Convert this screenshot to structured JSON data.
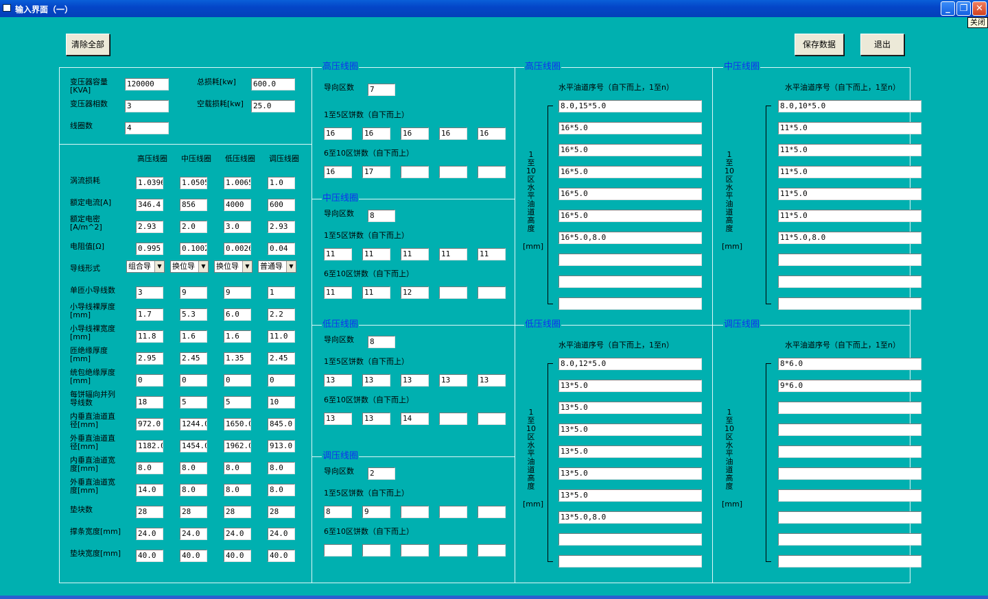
{
  "window": {
    "title": "输入界面（一）",
    "close_tip": "关闭"
  },
  "buttons": {
    "clear": "清除全部",
    "save": "保存数据",
    "exit": "退出"
  },
  "general": {
    "capacity_label": "变压器容量\n[KVA]",
    "capacity": "120000",
    "phases_label": "变压器相数",
    "phases": "3",
    "coils_label": "线圈数",
    "coils": "4",
    "total_loss_label": "总损耗[kw]",
    "total_loss": "600.0",
    "noload_loss_label": "空载损耗[kw]",
    "noload_loss": "25.0"
  },
  "params": {
    "headers": [
      "高压线圈",
      "中压线圈",
      "低压线圈",
      "调压线圈"
    ],
    "rows": [
      {
        "label": "涡流损耗",
        "type": "text",
        "values": [
          "1.0396",
          "1.0505",
          "1.0065",
          "1.0"
        ]
      },
      {
        "label": "额定电流[A]",
        "type": "text",
        "values": [
          "346.4",
          "856",
          "4000",
          "600"
        ]
      },
      {
        "label": "额定电密\n[A/m^2]",
        "type": "text",
        "values": [
          "2.93",
          "2.0",
          "3.0",
          "2.93"
        ]
      },
      {
        "label": "电阻值[Ω]",
        "type": "text",
        "values": [
          "0.995",
          "0.1002",
          "0.0026",
          "0.04"
        ]
      },
      {
        "label": "导线形式",
        "type": "select",
        "values": [
          "组合导",
          "换位导",
          "换位导",
          "普通导"
        ]
      },
      {
        "label": "单匝小导线数",
        "type": "text",
        "values": [
          "3",
          "9",
          "9",
          "1"
        ]
      },
      {
        "label": "小导线裸厚度\n[mm]",
        "type": "text",
        "values": [
          "1.7",
          "5.3",
          "6.0",
          "2.2"
        ]
      },
      {
        "label": "小导线裸宽度\n[mm]",
        "type": "text",
        "values": [
          "11.8",
          "1.6",
          "1.6",
          "11.0"
        ]
      },
      {
        "label": "匝绝缘厚度\n[mm]",
        "type": "text",
        "values": [
          "2.95",
          "2.45",
          "1.35",
          "2.45"
        ]
      },
      {
        "label": "统包绝缘厚度\n[mm]",
        "type": "text",
        "values": [
          "0",
          "0",
          "0",
          "0"
        ]
      },
      {
        "label": "每饼辐向并列\n导线数",
        "type": "text",
        "values": [
          "18",
          "5",
          "5",
          "10"
        ]
      },
      {
        "label": "内垂直油道直\n径[mm]",
        "type": "text",
        "values": [
          "972.0",
          "1244.0",
          "1650.0",
          "845.0"
        ]
      },
      {
        "label": "外垂直油道直\n径[mm]",
        "type": "text",
        "values": [
          "1182.0",
          "1454.0",
          "1962.0",
          "913.0"
        ]
      },
      {
        "label": "内垂直油道宽\n度[mm]",
        "type": "text",
        "values": [
          "8.0",
          "8.0",
          "8.0",
          "8.0"
        ]
      },
      {
        "label": "外垂直油道宽\n度[mm]",
        "type": "text",
        "values": [
          "14.0",
          "8.0",
          "8.0",
          "8.0"
        ]
      },
      {
        "label": "垫块数",
        "type": "text",
        "values": [
          "28",
          "28",
          "28",
          "28"
        ]
      },
      {
        "label": "撑条宽度[mm]",
        "type": "text",
        "values": [
          "24.0",
          "24.0",
          "24.0",
          "24.0"
        ]
      },
      {
        "label": "垫块宽度[mm]",
        "type": "text",
        "values": [
          "40.0",
          "40.0",
          "40.0",
          "40.0"
        ]
      }
    ]
  },
  "cake_labels": {
    "zones": "导向区数",
    "first": "1至5区饼数（自下而上）",
    "second": "6至10区饼数（自下而上）"
  },
  "cakes": [
    {
      "title": "高压线圈",
      "zones": "7",
      "first": [
        "16",
        "16",
        "16",
        "16",
        "16"
      ],
      "second": [
        "16",
        "17",
        "",
        "",
        ""
      ]
    },
    {
      "title": "中压线圈",
      "zones": "8",
      "first": [
        "11",
        "11",
        "11",
        "11",
        "11"
      ],
      "second": [
        "11",
        "11",
        "12",
        "",
        ""
      ]
    },
    {
      "title": "低压线圈",
      "zones": "8",
      "first": [
        "13",
        "13",
        "13",
        "13",
        "13"
      ],
      "second": [
        "13",
        "13",
        "14",
        "",
        ""
      ]
    },
    {
      "title": "调压线圈",
      "zones": "2",
      "first": [
        "8",
        "9",
        "",
        "",
        ""
      ],
      "second": [
        "",
        "",
        "",
        "",
        ""
      ]
    }
  ],
  "oil": {
    "header": "水平油道序号（自下而上，1至n）",
    "side_label": "1至10区水平油道高度",
    "unit": "[mm]",
    "panels": [
      {
        "title": "高压线圈",
        "values": [
          "8.0,15*5.0",
          "16*5.0",
          "16*5.0",
          "16*5.0",
          "16*5.0",
          "16*5.0",
          "16*5.0,8.0",
          "",
          "",
          ""
        ]
      },
      {
        "title": "中压线圈",
        "values": [
          "8.0,10*5.0",
          "11*5.0",
          "11*5.0",
          "11*5.0",
          "11*5.0",
          "11*5.0",
          "11*5.0,8.0",
          "",
          "",
          ""
        ]
      },
      {
        "title": "低压线圈",
        "values": [
          "8.0,12*5.0",
          "13*5.0",
          "13*5.0",
          "13*5.0",
          "13*5.0",
          "13*5.0",
          "13*5.0",
          "13*5.0,8.0",
          "",
          ""
        ]
      },
      {
        "title": "调压线圈",
        "values": [
          "8*6.0",
          "9*6.0",
          "",
          "",
          "",
          "",
          "",
          "",
          "",
          ""
        ]
      }
    ]
  }
}
